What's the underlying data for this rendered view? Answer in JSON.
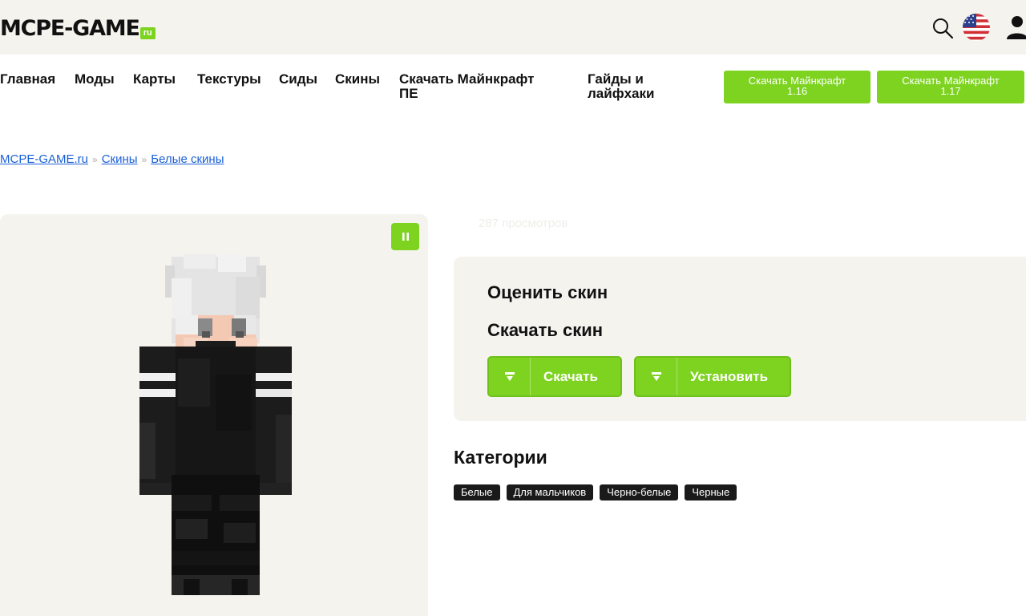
{
  "header": {
    "logo_main": "MCPE-GAME",
    "logo_suffix": "ru",
    "accent": "#7ed321"
  },
  "nav": {
    "items": [
      "Главная",
      "Моды",
      "Карты",
      "Текстуры",
      "Сиды",
      "Скины"
    ],
    "download_pe_line1": "Скачать Майнкрафт",
    "download_pe_line2": "ПЕ",
    "guides_line1": "Гайды и",
    "guides_line2": "лайфхаки"
  },
  "download_buttons": [
    {
      "line1": "Скачать Майнкрафт",
      "line2": "1.16"
    },
    {
      "line1": "Скачать Майнкрафт",
      "line2": "1.17"
    }
  ],
  "breadcrumb": {
    "items": [
      "MCPE-GAME.ru",
      "Скины",
      "Белые скины"
    ],
    "separator": "»"
  },
  "skin": {
    "views": "287 просмотров"
  },
  "actions": {
    "rate_title": "Оценить скин",
    "download_title": "Скачать скин",
    "download_label": "Скачать",
    "install_label": "Установить"
  },
  "categories": {
    "title": "Категории",
    "tags": [
      "Белые",
      "Для мальчиков",
      "Черно-белые",
      "Черные"
    ]
  },
  "icons": {
    "search": "search-icon",
    "flag": "us-flag-icon",
    "user": "user-icon",
    "pause": "pause-icon",
    "download": "download-icon"
  }
}
